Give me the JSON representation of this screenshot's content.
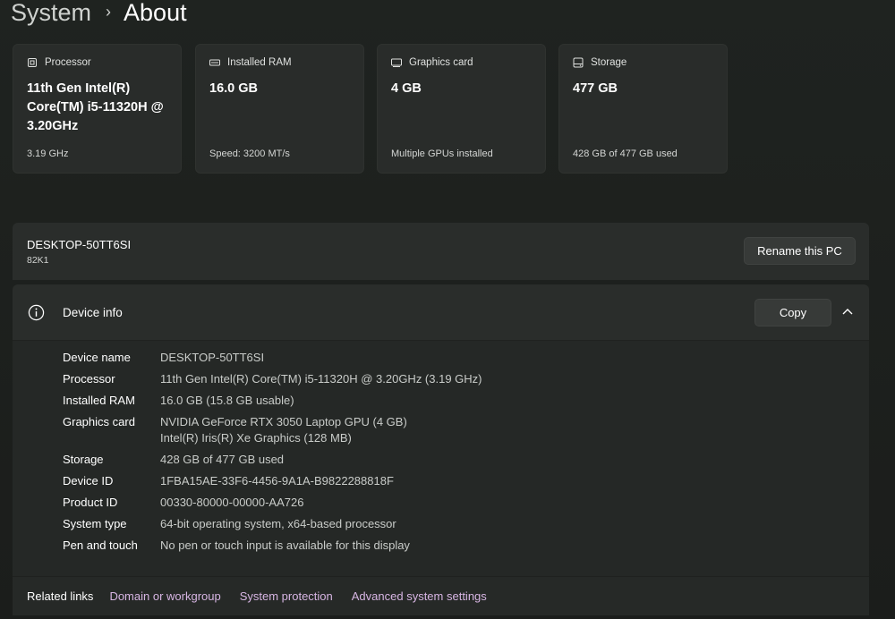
{
  "breadcrumb": {
    "parent": "System",
    "separator": "›",
    "current": "About"
  },
  "cards": [
    {
      "title": "Processor",
      "icon": "processor-icon",
      "value": "11th Gen Intel(R) Core(TM) i5-11320H @ 3.20GHz",
      "sub": "3.19 GHz"
    },
    {
      "title": "Installed RAM",
      "icon": "ram-icon",
      "value": "16.0 GB",
      "sub": "Speed: 3200 MT/s"
    },
    {
      "title": "Graphics card",
      "icon": "graphics-card-icon",
      "value": "4 GB",
      "sub": "Multiple GPUs installed"
    },
    {
      "title": "Storage",
      "icon": "storage-icon",
      "value": "477 GB",
      "sub": "428 GB of 477 GB used"
    }
  ],
  "pc": {
    "name": "DESKTOP-50TT6SI",
    "model": "82K1",
    "rename_label": "Rename this PC"
  },
  "device_info": {
    "title": "Device info",
    "copy_label": "Copy",
    "specs": [
      {
        "label": "Device name",
        "value": "DESKTOP-50TT6SI"
      },
      {
        "label": "Processor",
        "value": "11th Gen Intel(R) Core(TM) i5-11320H @ 3.20GHz (3.19 GHz)"
      },
      {
        "label": "Installed RAM",
        "value": "16.0 GB (15.8 GB usable)"
      },
      {
        "label": "Graphics card",
        "value": "NVIDIA GeForce RTX 3050 Laptop GPU (4 GB)",
        "value2": "Intel(R) Iris(R) Xe Graphics (128 MB)"
      },
      {
        "label": "Storage",
        "value": "428 GB of 477 GB used"
      },
      {
        "label": "Device ID",
        "value": "1FBA15AE-33F6-4456-9A1A-B9822288818F"
      },
      {
        "label": "Product ID",
        "value": "00330-80000-00000-AA726"
      },
      {
        "label": "System type",
        "value": "64-bit operating system, x64-based processor"
      },
      {
        "label": "Pen and touch",
        "value": "No pen or touch input is available for this display"
      }
    ]
  },
  "related_links": {
    "label": "Related links",
    "links": [
      "Domain or workgroup",
      "System protection",
      "Advanced system settings"
    ]
  },
  "colors": {
    "link": "#d7b5e3",
    "card_bg": "#292c2a",
    "panel_bg": "#252826"
  }
}
